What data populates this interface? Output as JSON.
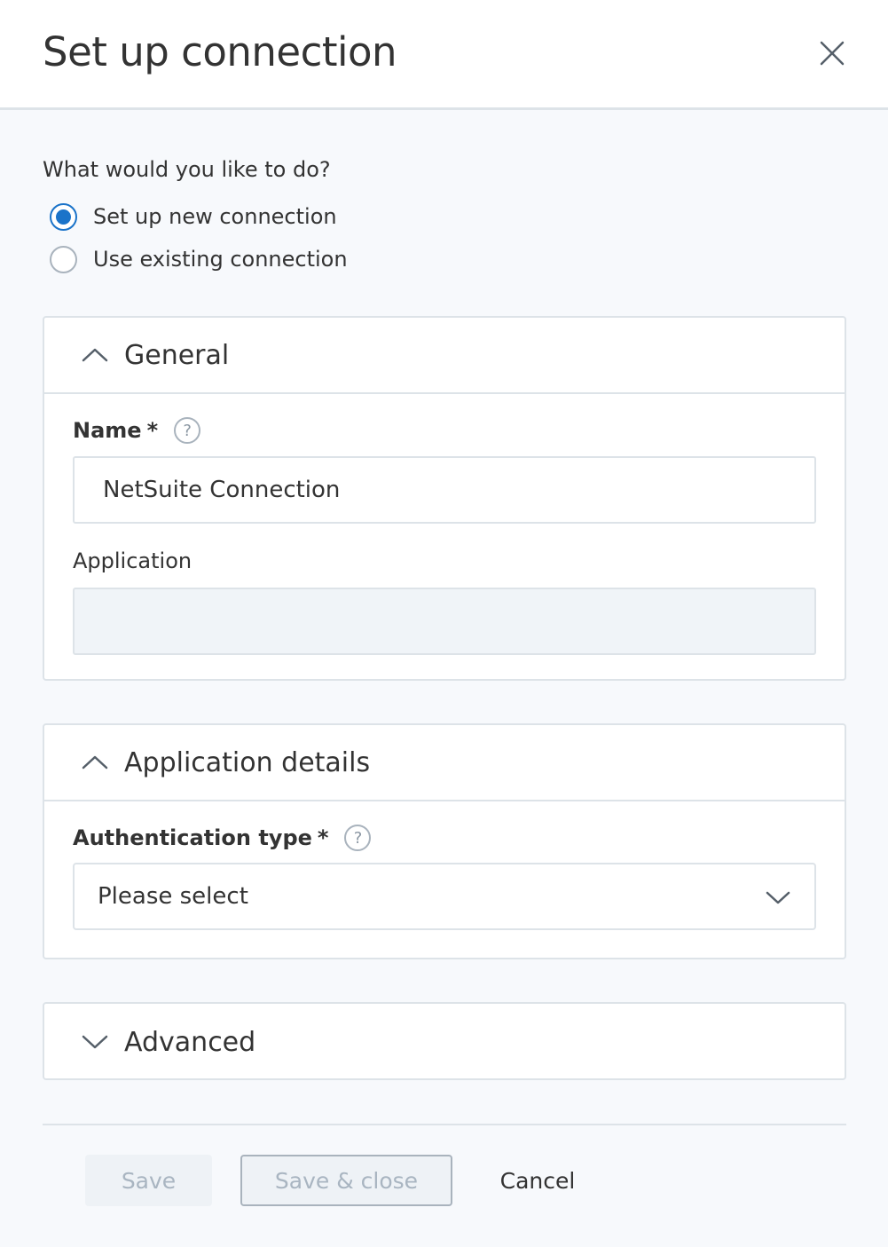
{
  "header": {
    "title": "Set up connection",
    "close_icon": "close-icon"
  },
  "mode": {
    "prompt": "What would you like to do?",
    "options": [
      {
        "label": "Set up new connection",
        "selected": true
      },
      {
        "label": "Use existing connection",
        "selected": false
      }
    ]
  },
  "general": {
    "title": "General",
    "expanded": true,
    "name_label": "Name",
    "required_marker": "*",
    "help_glyph": "?",
    "name_value": "NetSuite Connection",
    "application_label": "Application",
    "application_value": ""
  },
  "app_details": {
    "title": "Application details",
    "expanded": true,
    "auth_label": "Authentication type",
    "required_marker": "*",
    "help_glyph": "?",
    "auth_value": "Please select"
  },
  "advanced": {
    "title": "Advanced",
    "expanded": false
  },
  "footer": {
    "save_label": "Save",
    "save_close_label": "Save & close",
    "cancel_label": "Cancel"
  },
  "colors": {
    "accent": "#1a73c9",
    "border": "#dde3e8",
    "disabled_text": "#a9b5c1"
  }
}
